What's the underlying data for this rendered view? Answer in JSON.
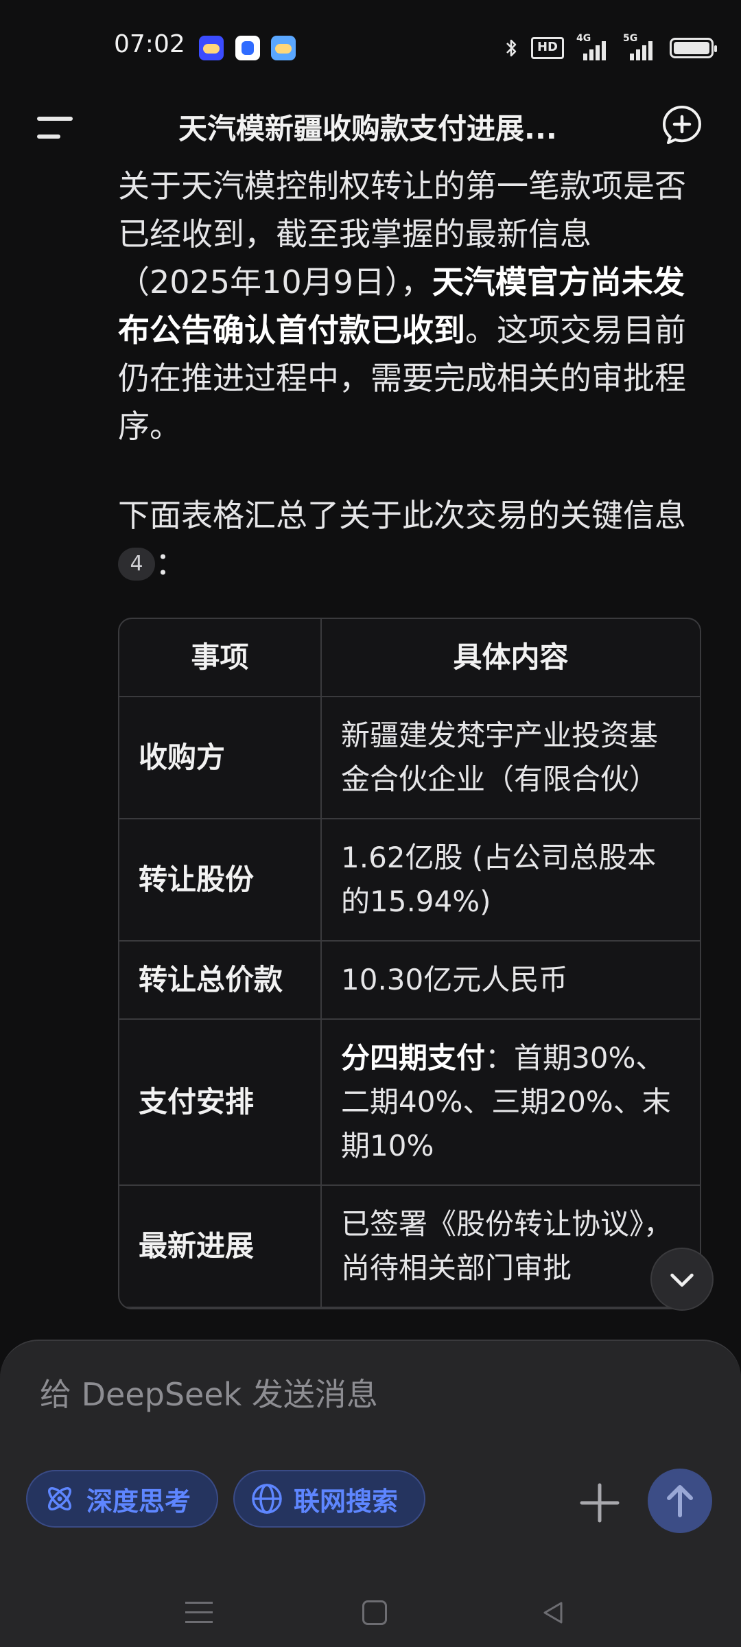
{
  "status_bar": {
    "time": "07:02",
    "hd_badge": "HD",
    "network_1": "4G",
    "network_2": "5G",
    "icons": [
      "weather-app-icon",
      "baidu-app-icon",
      "weather-app-icon-2",
      "bluetooth-icon",
      "signal-icon",
      "battery-icon"
    ]
  },
  "header": {
    "title": "天汽模新疆收购款支付进展..."
  },
  "message": {
    "p1_part1": "关于天汽模控制权转让的第一笔款项是否已经收到，截至我掌握的最新信息（2025年10月9日），",
    "p1_bold": "天汽模官方尚未发布公告确认首付款已收到",
    "p1_part2": "。这项交易目前仍在推进过程中，需要完成相关的审批程序。",
    "p2_text": "下面表格汇总了关于此次交易的关键信息",
    "citation": "4",
    "p2_suffix": "："
  },
  "table": {
    "headers": [
      "事项",
      "具体内容"
    ],
    "rows": [
      {
        "key": "收购方",
        "value": "新疆建发梵宇产业投资基金合伙企业（有限合伙）"
      },
      {
        "key": "转让股份",
        "value": "1.62亿股 (占公司总股本的15.94%)"
      },
      {
        "key": "转让总价款",
        "value": "10.30亿元人民币"
      },
      {
        "key": "支付安排",
        "value_bold": "分四期支付",
        "value_rest": "：首期30%、二期40%、三期20%、末期10%"
      },
      {
        "key": "最新进展",
        "value": "已签署《股份转让协议》，尚待相关部门审批"
      }
    ]
  },
  "composer": {
    "placeholder": "给 DeepSeek 发送消息",
    "deep_think_label": "深度思考",
    "web_search_label": "联网搜索"
  },
  "colors": {
    "background": "#0f0f10",
    "panel": "#262628",
    "accent": "#5e86ff",
    "accent_bg": "#25345f",
    "send_button": "#3c4d86"
  }
}
